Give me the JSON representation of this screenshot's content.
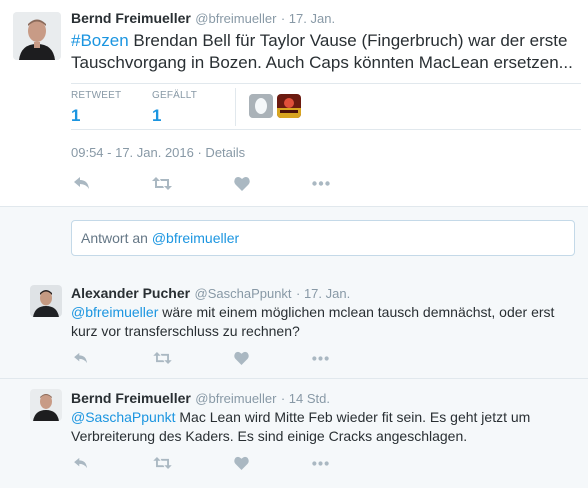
{
  "main_tweet": {
    "name": "Bernd Freimueller",
    "handle": "@bfreimueller",
    "date": "· 17. Jan.",
    "hashtag": "#Bozen",
    "text_line1": " Brendan Bell für Taylor Vause (Fingerbruch) war der erste",
    "text_line2": "Tauschvorgang in Bozen. Auch Caps könnten MacLean ersetzen...",
    "retweet_label": "RETWEET",
    "retweet_count": "1",
    "like_label": "GEFÄLLT",
    "like_count": "1",
    "timestamp": "09:54 - 17. Jan. 2016 · Details"
  },
  "reply_box": {
    "prefix": "Antwort an ",
    "mention": "@bfreimueller"
  },
  "replies": [
    {
      "name": "Alexander Pucher",
      "handle": "@SaschaPpunkt",
      "date": "· 17. Jan.",
      "mention": "@bfreimueller",
      "text_line1": " wäre mit einem möglichen mclean tausch demnächst, oder erst",
      "text_line2": "kurz vor transferschluss zu rechnen?"
    },
    {
      "name": "Bernd Freimueller",
      "handle": "@bfreimueller",
      "date": "· 14 Std.",
      "mention": "@SaschaPpunkt",
      "text_line1": " Mac Lean wird Mitte Feb wieder fit sein. Es geht jetzt um",
      "text_line2": "Verbreiterung des Kaders. Es sind einige Cracks angeschlagen."
    }
  ],
  "colors": {
    "link": "#1b95e0",
    "meta": "#8899a6",
    "icon": "#aab8c2",
    "border": "#e1e8ed",
    "reply_bg": "#f5f8fa"
  },
  "icons": [
    "reply-icon",
    "retweet-icon",
    "like-icon",
    "more-icon"
  ]
}
